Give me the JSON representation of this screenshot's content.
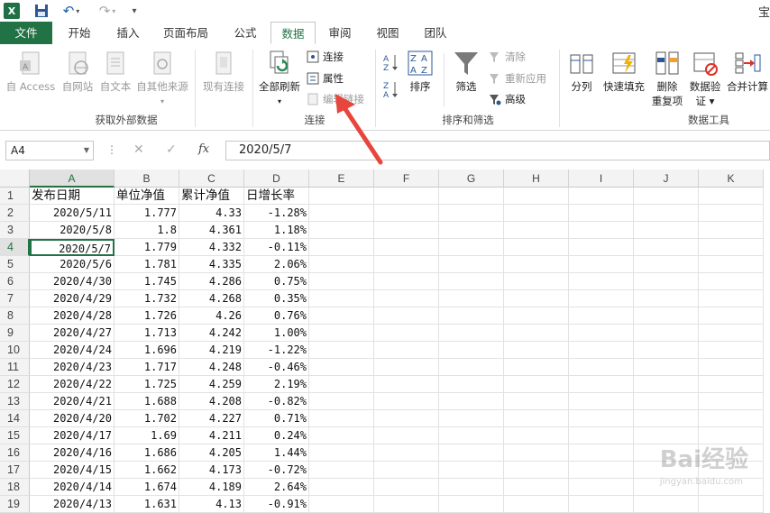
{
  "titlebar": {
    "logo_text": "X",
    "window_title": "宝"
  },
  "tabs": [
    {
      "label": "文件"
    },
    {
      "label": "开始"
    },
    {
      "label": "插入"
    },
    {
      "label": "页面布局"
    },
    {
      "label": "公式"
    },
    {
      "label": "数据"
    },
    {
      "label": "审阅"
    },
    {
      "label": "视图"
    },
    {
      "label": "团队"
    }
  ],
  "ribbon": {
    "external": {
      "access": "自 Access",
      "web": "自网站",
      "text": "自文本",
      "other": "自其他来源",
      "existing": "现有连接",
      "group": "获取外部数据"
    },
    "connections": {
      "refresh_all": "全部刷新",
      "connections": "连接",
      "properties": "属性",
      "edit_links": "编辑链接",
      "group": "连接"
    },
    "sort_filter": {
      "sort": "排序",
      "filter": "筛选",
      "clear": "清除",
      "reapply": "重新应用",
      "advanced": "高级",
      "group": "排序和筛选"
    },
    "tools": {
      "split": "分列",
      "flash_fill": "快速填充",
      "remove_dup_1": "删除",
      "remove_dup_2": "重复项",
      "validation_1": "数据验",
      "validation_2": "证 ▾",
      "consolidate": "合并计算",
      "group": "数据工具"
    }
  },
  "formula_bar": {
    "name_box": "A4",
    "formula": "2020/5/7",
    "fx": "fx"
  },
  "columns": [
    "A",
    "B",
    "C",
    "D",
    "E",
    "F",
    "G",
    "H",
    "I",
    "J",
    "K"
  ],
  "rows": [
    [
      "发布日期",
      "单位净值",
      "累计净值",
      "日增长率"
    ],
    [
      "2020/5/11",
      "1.777",
      "4.33",
      "-1.28%"
    ],
    [
      "2020/5/8",
      "1.8",
      "4.361",
      "1.18%"
    ],
    [
      "2020/5/7",
      "1.779",
      "4.332",
      "-0.11%"
    ],
    [
      "2020/5/6",
      "1.781",
      "4.335",
      "2.06%"
    ],
    [
      "2020/4/30",
      "1.745",
      "4.286",
      "0.75%"
    ],
    [
      "2020/4/29",
      "1.732",
      "4.268",
      "0.35%"
    ],
    [
      "2020/4/28",
      "1.726",
      "4.26",
      "0.76%"
    ],
    [
      "2020/4/27",
      "1.713",
      "4.242",
      "1.00%"
    ],
    [
      "2020/4/24",
      "1.696",
      "4.219",
      "-1.22%"
    ],
    [
      "2020/4/23",
      "1.717",
      "4.248",
      "-0.46%"
    ],
    [
      "2020/4/22",
      "1.725",
      "4.259",
      "2.19%"
    ],
    [
      "2020/4/21",
      "1.688",
      "4.208",
      "-0.82%"
    ],
    [
      "2020/4/20",
      "1.702",
      "4.227",
      "0.71%"
    ],
    [
      "2020/4/17",
      "1.69",
      "4.211",
      "0.24%"
    ],
    [
      "2020/4/16",
      "1.686",
      "4.205",
      "1.44%"
    ],
    [
      "2020/4/15",
      "1.662",
      "4.173",
      "-0.72%"
    ],
    [
      "2020/4/14",
      "1.674",
      "4.189",
      "2.64%"
    ],
    [
      "2020/4/13",
      "1.631",
      "4.13",
      "-0.91%"
    ]
  ],
  "active_cell": "A4",
  "watermark": {
    "brand": "Bai经验",
    "site": "jingyan.baidu.com"
  },
  "colors": {
    "accent": "#217346",
    "arrow": "#e8453c"
  }
}
